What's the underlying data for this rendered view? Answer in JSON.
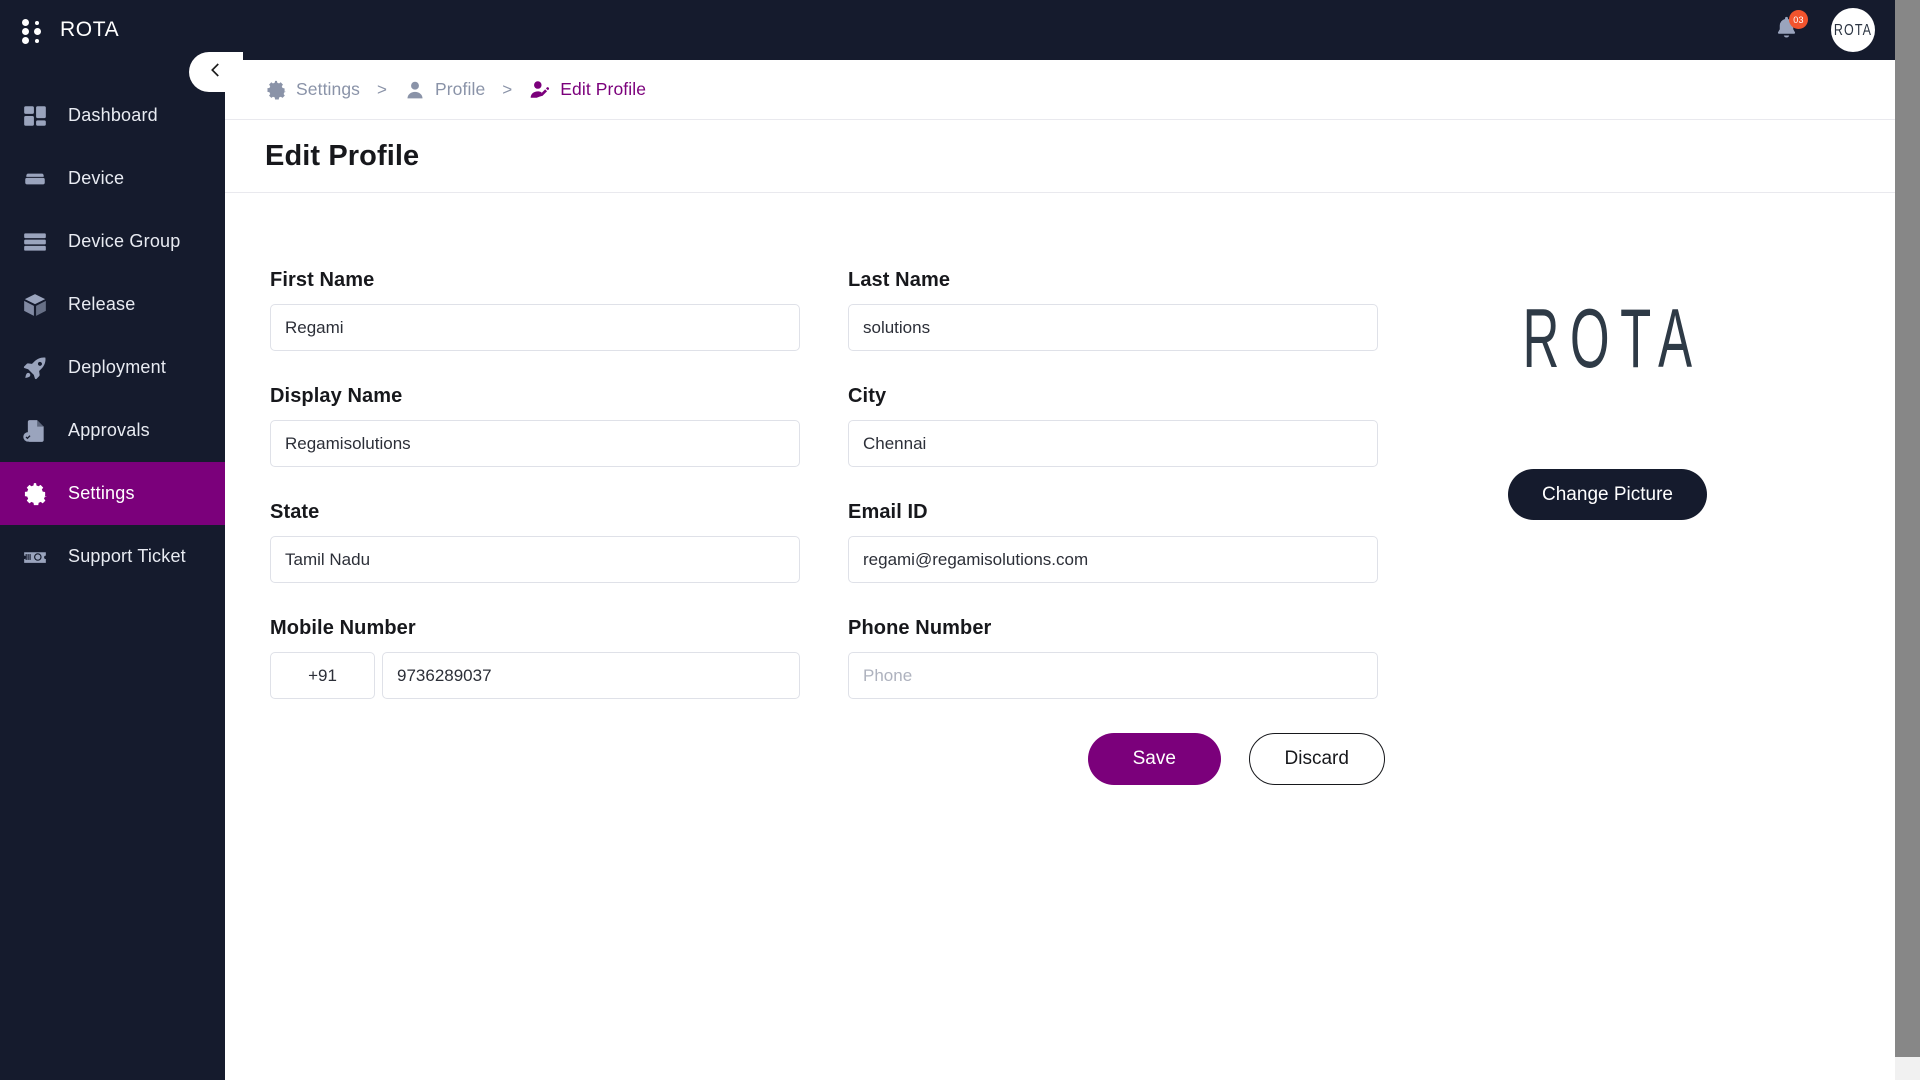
{
  "brand": {
    "name": "ROTA",
    "logo_icon": "dots-grid-icon"
  },
  "topbar": {
    "notification_icon": "bell-icon",
    "notification_count": "03",
    "avatar_label": "ROTA",
    "accent_badge_color": "#f2542d"
  },
  "collapse_button": {
    "icon": "chevron-left-icon"
  },
  "sidebar": {
    "active_color": "#7b007b",
    "background": "#151b2d",
    "items": [
      {
        "label": "Dashboard",
        "icon": "dashboard-grid-icon",
        "active": false
      },
      {
        "label": "Device",
        "icon": "server-device-icon",
        "active": false
      },
      {
        "label": "Device Group",
        "icon": "server-stack-icon",
        "active": false
      },
      {
        "label": "Release",
        "icon": "box-package-icon",
        "active": false
      },
      {
        "label": "Deployment",
        "icon": "rocket-icon",
        "active": false
      },
      {
        "label": "Approvals",
        "icon": "document-check-icon",
        "active": false
      },
      {
        "label": "Settings",
        "icon": "gear-icon",
        "active": true
      },
      {
        "label": "Support Ticket",
        "icon": "ticket-gear-icon",
        "active": false
      }
    ]
  },
  "breadcrumb": {
    "separator": ">",
    "items": [
      {
        "label": "Settings",
        "icon": "gear-icon",
        "current": false
      },
      {
        "label": "Profile",
        "icon": "user-icon",
        "current": false
      },
      {
        "label": "Edit Profile",
        "icon": "user-edit-icon",
        "current": true
      }
    ]
  },
  "page": {
    "title": "Edit Profile"
  },
  "form": {
    "fields": [
      {
        "label": "First Name",
        "value": "Regami",
        "placeholder": ""
      },
      {
        "label": "Last Name",
        "value": "solutions",
        "placeholder": ""
      },
      {
        "label": "Display Name",
        "value": "Regamisolutions",
        "placeholder": ""
      },
      {
        "label": "City",
        "value": "Chennai",
        "placeholder": ""
      },
      {
        "label": "State",
        "value": "Tamil Nadu",
        "placeholder": ""
      },
      {
        "label": "Email ID",
        "value": "regami@regamisolutions.com",
        "placeholder": ""
      }
    ],
    "mobile": {
      "label": "Mobile Number",
      "country_code": "+91",
      "value": "9736289037"
    },
    "phone": {
      "label": "Phone Number",
      "value": "",
      "placeholder": "Phone"
    }
  },
  "actions": {
    "save_label": "Save",
    "discard_label": "Discard",
    "save_color": "#7b007b"
  },
  "picture_panel": {
    "logo_text": "ROTA",
    "change_picture_label": "Change Picture"
  }
}
